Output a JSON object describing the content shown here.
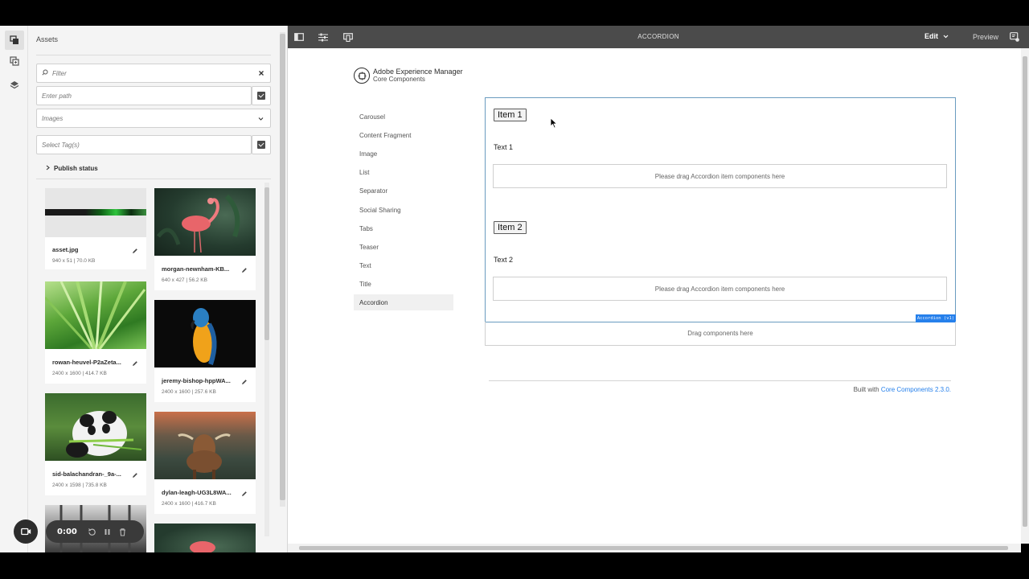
{
  "toolbar": {
    "title": "ACCORDION",
    "edit_label": "Edit",
    "preview_label": "Preview",
    "icons": [
      "side-panel-icon",
      "page-properties-icon",
      "emulator-icon",
      "annotations-icon"
    ]
  },
  "rail": {
    "icons": [
      "assets-icon",
      "components-icon",
      "content-tree-icon"
    ]
  },
  "panel": {
    "title": "Assets",
    "filter_placeholder": "Filter",
    "path_placeholder": "Enter path",
    "type_selected": "Images",
    "tags_placeholder": "Select Tag(s)",
    "publish_status": "Publish status",
    "assets": [
      {
        "name": "asset.jpg",
        "meta": "940 x 51 | 70.0 KB"
      },
      {
        "name": "morgan-newnham-KB...",
        "meta": "640 x 427 | 56.2 KB"
      },
      {
        "name": "rowan-heuvel-P2aZeta...",
        "meta": "2400 x 1600 | 414.7 KB"
      },
      {
        "name": "jeremy-bishop-hppWA...",
        "meta": "2400 x 1600 | 257.6 KB"
      },
      {
        "name": "sid-balachandran-_9a-...",
        "meta": "2400 x 1598 | 735.8 KB"
      },
      {
        "name": "dylan-leagh-UG3L8WA...",
        "meta": "2400 x 1600 | 416.7 KB"
      }
    ]
  },
  "recorder": {
    "time": "0:00"
  },
  "page": {
    "logo_line1": "Adobe Experience Manager",
    "logo_line2": "Core Components",
    "nav": [
      "Carousel",
      "Content Fragment",
      "Image",
      "List",
      "Separator",
      "Social Sharing",
      "Tabs",
      "Teaser",
      "Text",
      "Title",
      "Accordion"
    ],
    "nav_active": "Accordion",
    "accordion": {
      "items": [
        {
          "title": "Item 1",
          "text": "Text 1",
          "drop": "Please drag Accordion item components here"
        },
        {
          "title": "Item 2",
          "text": "Text 2",
          "drop": "Please drag Accordion item components here"
        }
      ],
      "tag": "Accordion (v1)"
    },
    "drop_main": "Drag components here",
    "footer_prefix": "Built with ",
    "footer_link": "Core Components 2.3.0."
  }
}
